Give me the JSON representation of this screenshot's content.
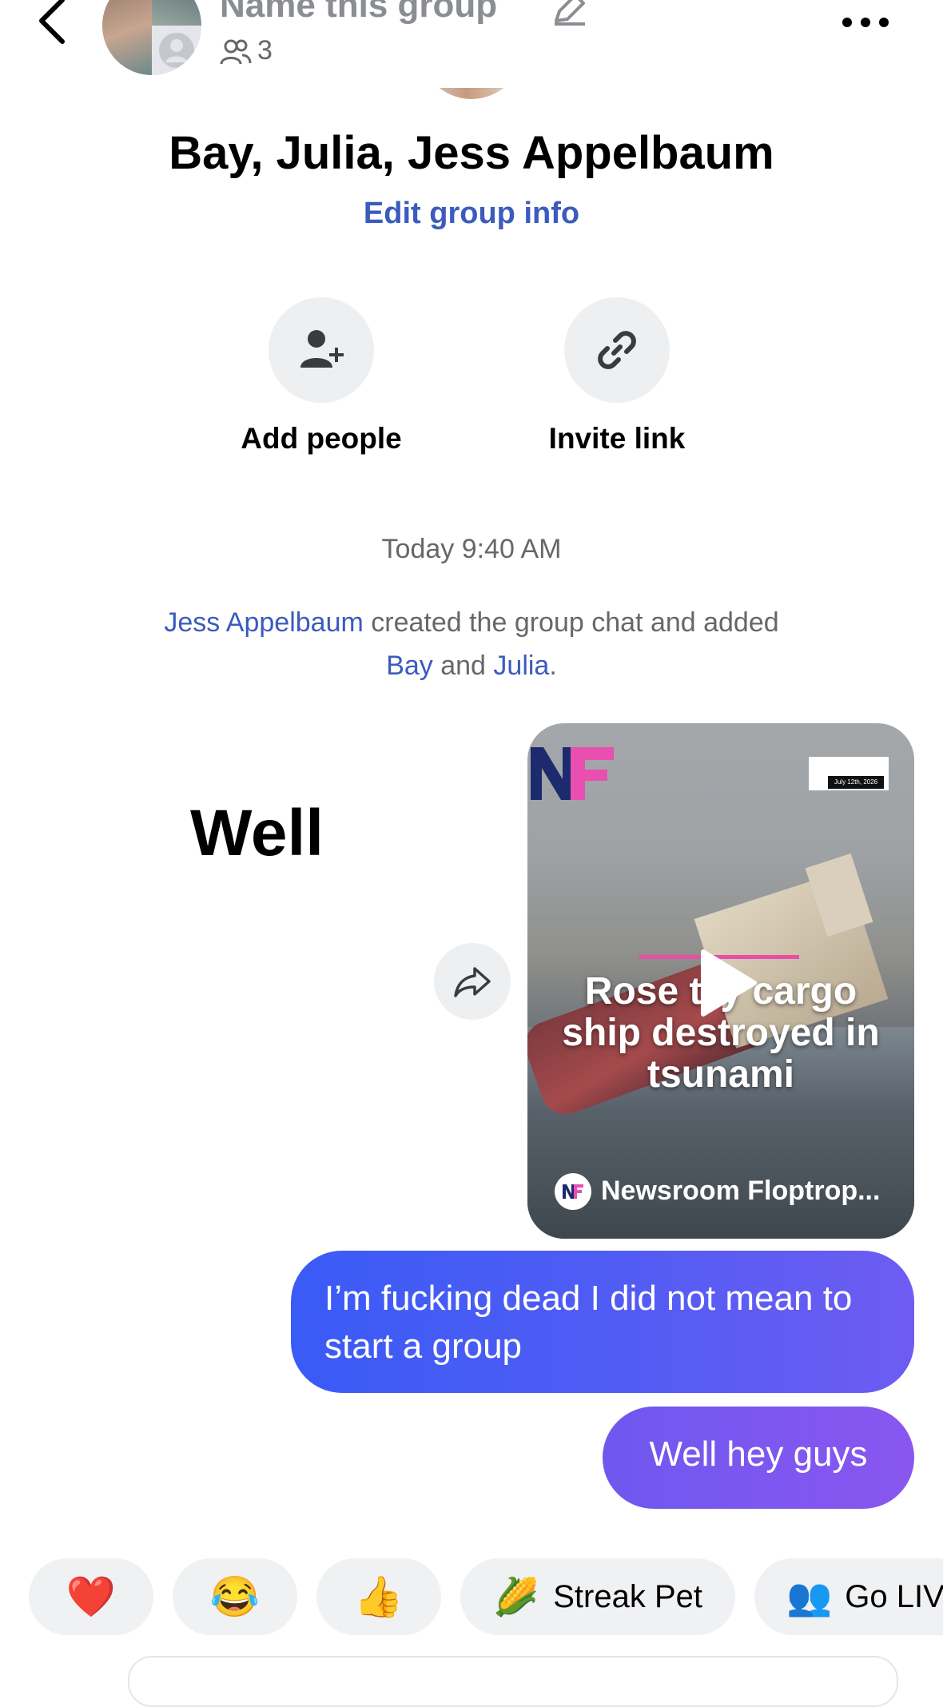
{
  "header": {
    "title": "Name this group",
    "members_count": "3"
  },
  "group": {
    "name": "Bay, Julia, Jess Appelbaum",
    "edit_link": "Edit group info"
  },
  "actions": [
    {
      "label": "Add people",
      "icon": "add-person-icon"
    },
    {
      "label": "Invite link",
      "icon": "link-icon"
    }
  ],
  "timestamp": "Today 9:40 AM",
  "system_message": {
    "creator": "Jess Appelbaum",
    "text1": " created the group chat and added ",
    "person1": "Bay",
    "text2": " and ",
    "person2": "Julia",
    "text3": "."
  },
  "messages": {
    "received_text": "Well",
    "shared_video": {
      "headline": "Rose t  y cargo ship destroyed in tsunami",
      "logo": "NF",
      "badge_date": "July 12th, 2026",
      "source": "Newsroom Floptrop..."
    },
    "sent": [
      "I’m fucking dead I did not mean to start a group",
      "Well hey guys"
    ]
  },
  "quick_replies": [
    {
      "emoji": "❤️",
      "label": ""
    },
    {
      "emoji": "😂",
      "label": ""
    },
    {
      "emoji": "👍",
      "label": ""
    },
    {
      "emoji": "🌽",
      "label": "Streak Pet"
    },
    {
      "emoji": "👥",
      "label": "Go LIV"
    }
  ],
  "colors": {
    "accent_link": "#3b5bbd",
    "bubble_start": "#3a5bf6",
    "bubble_end": "#8a56f0",
    "chip_bg": "#f0f1f3"
  }
}
